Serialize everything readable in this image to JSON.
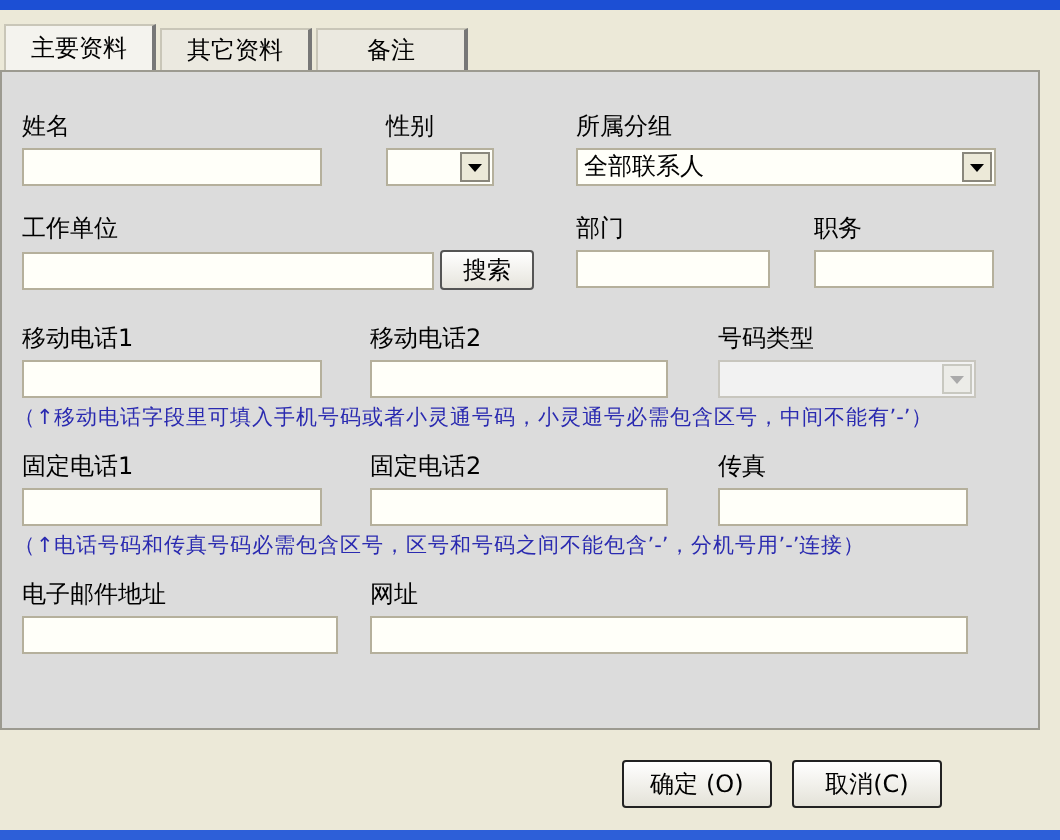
{
  "tabs": [
    {
      "label": "主要资料",
      "selected": true
    },
    {
      "label": "其它资料",
      "selected": false
    },
    {
      "label": "备注",
      "selected": false
    }
  ],
  "sections": [
    {
      "kind": "fields",
      "fields": [
        {
          "kind": "text",
          "label": "姓名",
          "disabled": false
        },
        {
          "kind": "select",
          "label": "性别",
          "disabled": false
        },
        {
          "kind": "select",
          "label": "所属分组",
          "value": "全部联系人",
          "disabled": false
        }
      ]
    },
    {
      "kind": "fields",
      "fields": [
        {
          "kind": "search",
          "label": "工作单位",
          "button": "搜索",
          "disabled": false
        },
        {
          "kind": "text",
          "label": "部门",
          "disabled": false
        },
        {
          "kind": "text",
          "label": "职务",
          "disabled": false
        }
      ]
    },
    {
      "kind": "fields",
      "fields": [
        {
          "kind": "text",
          "label": "移动电话1",
          "disabled": false
        },
        {
          "kind": "text",
          "label": "移动电话2",
          "disabled": false
        },
        {
          "kind": "select",
          "label": "号码类型",
          "disabled": true
        }
      ]
    },
    {
      "kind": "note",
      "text": "（↑移动电话字段里可填入手机号码或者小灵通号码，小灵通号必需包含区号，中间不能有’-’）"
    },
    {
      "kind": "fields",
      "fields": [
        {
          "kind": "text",
          "label": "固定电话1",
          "disabled": false
        },
        {
          "kind": "text",
          "label": "固定电话2",
          "disabled": false
        },
        {
          "kind": "text",
          "label": "传真",
          "disabled": false
        }
      ]
    },
    {
      "kind": "note",
      "text": "（↑电话号码和传真号码必需包含区号，区号和号码之间不能包含’-’，分机号用’-’连接）"
    },
    {
      "kind": "fields",
      "fields": [
        {
          "kind": "text",
          "label": "电子邮件地址",
          "disabled": false
        },
        {
          "kind": "text",
          "label": "网址",
          "disabled": false
        }
      ]
    }
  ],
  "buttons": [
    "确定 (O)",
    "取消(C)"
  ]
}
